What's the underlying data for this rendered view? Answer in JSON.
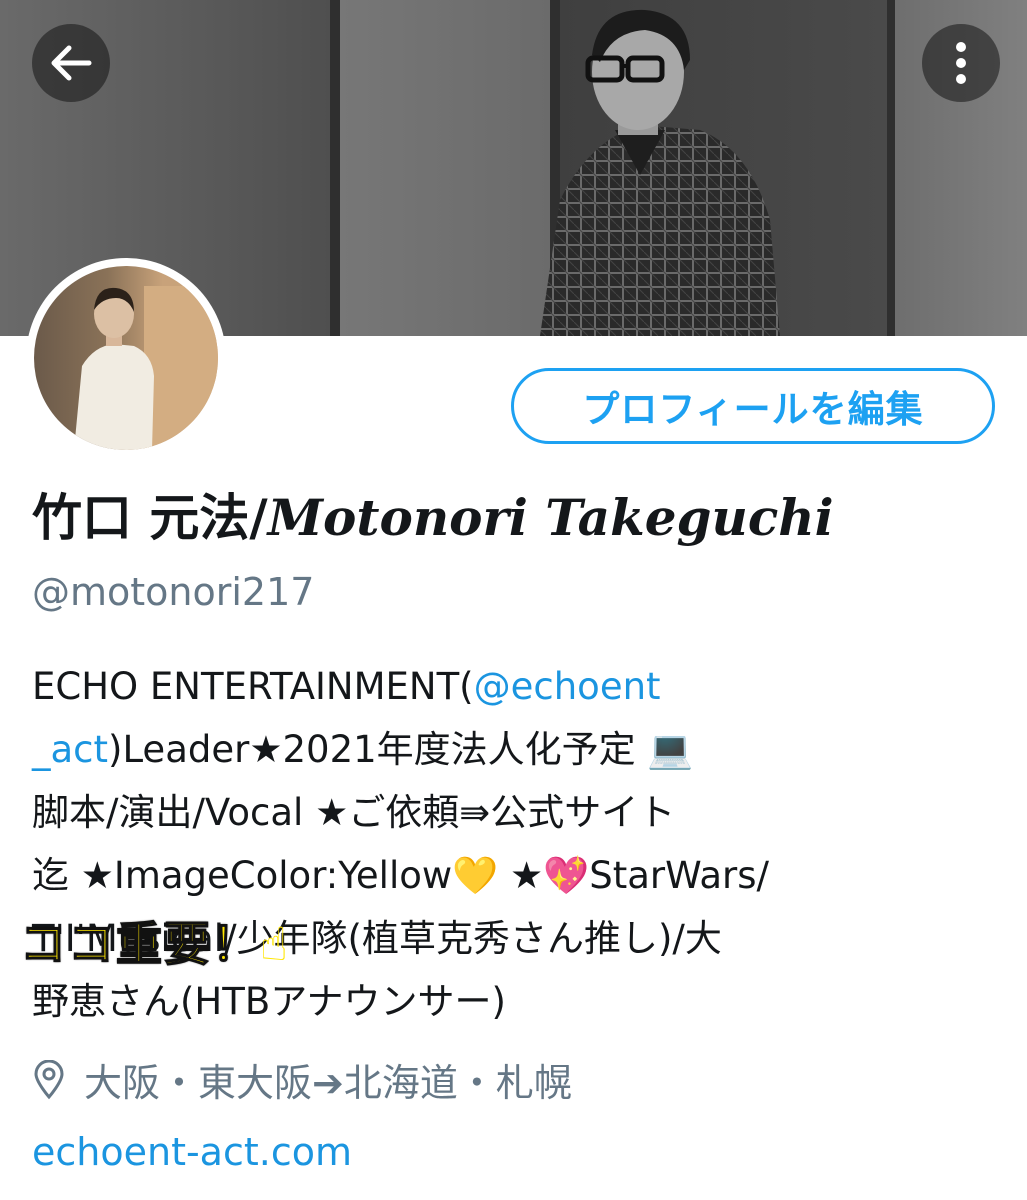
{
  "header": {
    "back_icon": "arrow-left-icon",
    "more_icon": "more-vertical-icon"
  },
  "profile": {
    "edit_button_label": "プロフィールを編集",
    "display_name_jp": "竹口 元法/",
    "display_name_en": "Motonori Takeguchi",
    "handle": "@motonori217"
  },
  "bio": {
    "line1_text": "ECHO ENTERTAINMENT(",
    "line1_link": "@echoent",
    "line2_link": "_act",
    "line2_text": ")Leader★2021年度法人化予定 ",
    "line2_emoji": "💻",
    "line3": "脚本/演出/Vocal ★ご依頼⇛公式サイト",
    "line4_a": "迄 ★ImageColor:Yellow",
    "line4_emoji1": "💛",
    "line4_b": " ★",
    "line4_emoji2": "💖",
    "line4_c": "StarWars/",
    "line5": "T'I'Musical/少年隊(植草克秀さん推し)/大",
    "line6": "野恵さん(HTBアナウンサー)"
  },
  "overlay": {
    "text": "ココ重要！",
    "emoji": "☝"
  },
  "meta": {
    "location_icon": "location-pin-icon",
    "location": "大阪・東大阪➔北海道・札幌",
    "website": "echoent-act.com"
  },
  "colors": {
    "accent": "#1da1f2",
    "link": "#1b95e0",
    "secondary_text": "#657786",
    "overlay_yellow": "#ffe600"
  }
}
